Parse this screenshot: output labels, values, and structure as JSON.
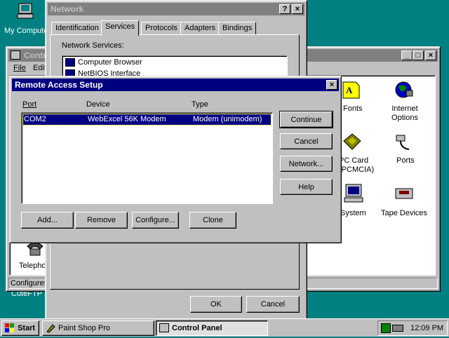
{
  "desktop": {
    "icons": [
      {
        "label": "My Computer"
      },
      {
        "label": "CuteFTP"
      }
    ]
  },
  "control_panel": {
    "title": "Control Panel",
    "menu": [
      "File",
      "Edit"
    ],
    "items": [
      {
        "label": "Fonts",
        "icon": "fonts-icon"
      },
      {
        "label": "Internet Options",
        "icon": "internet-options-icon"
      },
      {
        "label": "PC Card (PCMCIA)",
        "icon": "pc-card-icon"
      },
      {
        "label": "Ports",
        "icon": "ports-icon"
      },
      {
        "label": "System",
        "icon": "system-icon"
      },
      {
        "label": "Tape Devices",
        "icon": "tape-devices-icon"
      },
      {
        "label": "Telephony",
        "icon": "telephony-icon"
      }
    ],
    "status": "Configures"
  },
  "network": {
    "title": "Network",
    "tabs": [
      "Identification",
      "Services",
      "Protocols",
      "Adapters",
      "Bindings"
    ],
    "active_tab": "Services",
    "services_label": "Network Services:",
    "services": [
      "Computer Browser",
      "NetBIOS Interface"
    ],
    "ok_label": "OK",
    "cancel_label": "Cancel"
  },
  "ras": {
    "title": "Remote Access Setup",
    "columns": [
      "Port",
      "Device",
      "Type"
    ],
    "rows": [
      {
        "port": "COM2",
        "device": "WebExcel 56K Modem",
        "type": "Modem (unimodem)"
      }
    ],
    "buttons": {
      "continue": "Continue",
      "cancel": "Cancel",
      "network": "Network...",
      "help": "Help",
      "add": "Add...",
      "remove": "Remove",
      "configure": "Configure...",
      "clone": "Clone"
    }
  },
  "taskbar": {
    "start": "Start",
    "tasks": [
      {
        "label": "Paint Shop Pro",
        "active": false
      },
      {
        "label": "Control Panel",
        "active": true
      }
    ],
    "clock": "12:09 PM"
  }
}
